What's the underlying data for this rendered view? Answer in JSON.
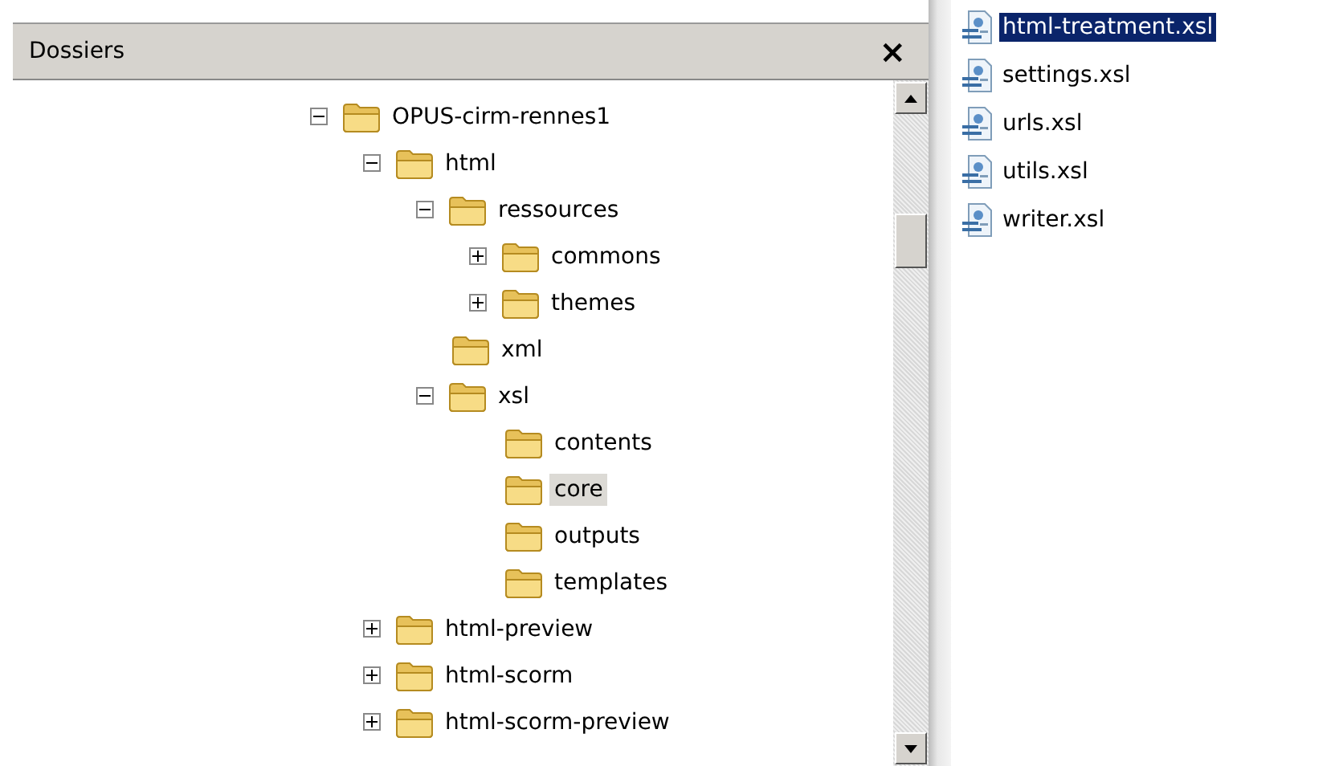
{
  "panel": {
    "title": "Dossiers",
    "close": "×"
  },
  "tree": [
    {
      "label": "OPUS-cirm-rennes1",
      "expanded": true,
      "selected": false,
      "children": [
        {
          "label": "html",
          "expanded": true,
          "selected": false,
          "children": [
            {
              "label": "ressources",
              "expanded": true,
              "selected": false,
              "children": [
                {
                  "label": "commons",
                  "expanded": false,
                  "selected": false
                },
                {
                  "label": "themes",
                  "expanded": false,
                  "selected": false
                }
              ]
            },
            {
              "label": "xml",
              "selected": false
            },
            {
              "label": "xsl",
              "expanded": true,
              "selected": false,
              "children": [
                {
                  "label": "contents",
                  "selected": false
                },
                {
                  "label": "core",
                  "selected": true
                },
                {
                  "label": "outputs",
                  "selected": false
                },
                {
                  "label": "templates",
                  "selected": false
                }
              ]
            }
          ]
        },
        {
          "label": "html-preview",
          "expanded": false,
          "selected": false
        },
        {
          "label": "html-scorm",
          "expanded": false,
          "selected": false
        },
        {
          "label": "html-scorm-preview",
          "expanded": false,
          "selected": false
        }
      ]
    }
  ],
  "files": [
    {
      "name": "html-treatment.xsl",
      "selected": true
    },
    {
      "name": "settings.xsl",
      "selected": false
    },
    {
      "name": "urls.xsl",
      "selected": false
    },
    {
      "name": "utils.xsl",
      "selected": false
    },
    {
      "name": "writer.xsl",
      "selected": false
    }
  ]
}
